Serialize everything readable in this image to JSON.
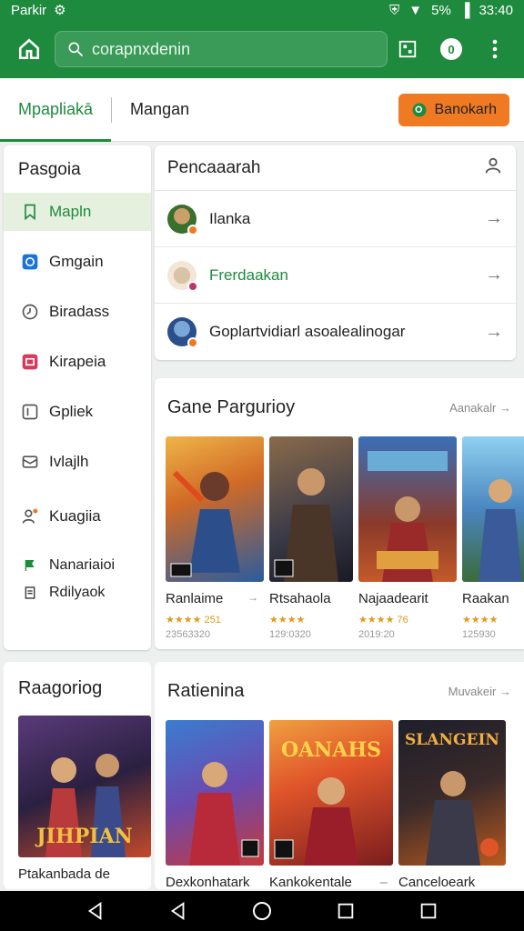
{
  "status_bar": {
    "left_text": "Parkir",
    "battery": "5%",
    "time": "33:40"
  },
  "app_bar": {
    "search_text": "corapnxdenin"
  },
  "tabs": [
    {
      "label": "Mpapliakā",
      "active": true
    },
    {
      "label": "Mangan",
      "active": false
    }
  ],
  "primary_button": {
    "label": "Banokarh"
  },
  "sidebar": {
    "title": "Pasgoia",
    "items": [
      {
        "label": "Mapln",
        "icon": "bookmark-icon",
        "active": true
      },
      {
        "label": "Gmgain",
        "icon": "blue-square-icon"
      },
      {
        "label": "Biradass",
        "icon": "clock-icon"
      },
      {
        "label": "Kirapeia",
        "icon": "red-app-icon"
      },
      {
        "label": "Gpliek",
        "icon": "square-outline-icon"
      },
      {
        "label": "Ivlajlh",
        "icon": "mail-icon"
      },
      {
        "label": "Kuagiia",
        "icon": "person-icon"
      }
    ],
    "footer": [
      {
        "label": "Nanariaioi",
        "icon": "flag-icon"
      },
      {
        "label": "Rdilyaok",
        "icon": "doc-icon"
      }
    ]
  },
  "list_card": {
    "title": "Pencaaarah",
    "rows": [
      {
        "label": "Ilanka",
        "color": "#2f7d3a"
      },
      {
        "label": "Frerdaakan",
        "color": "#1e8a3e"
      },
      {
        "label": "Goplartvidiarl asoalealinogar",
        "color": "#222"
      }
    ]
  },
  "games_section": {
    "title": "Gane Pargurioy",
    "more": "Aanakalr",
    "games": [
      {
        "name": "Ranlaime",
        "rating": "★★★★ 251",
        "downloads": "23563320",
        "colors": [
          "#e8a23a",
          "#2a5c9e"
        ]
      },
      {
        "name": "Rtsahaola",
        "rating": "★★★★",
        "downloads": "129:0320",
        "colors": [
          "#6a4b3a",
          "#2c2c3a"
        ]
      },
      {
        "name": "Najaadearit",
        "rating": "★★★★ 76",
        "downloads": "2019:20",
        "colors": [
          "#3a6fb8",
          "#c45a2a"
        ]
      },
      {
        "name": "Raakan",
        "rating": "★★★★",
        "downloads": "125930",
        "colors": [
          "#6fb3e0",
          "#3b6b3a"
        ]
      }
    ]
  },
  "bottom_left": {
    "title": "Raagoriog",
    "art_title": "JIHPIAN",
    "caption": "Ptakanbada de"
  },
  "bottom_right": {
    "title": "Ratienina",
    "more": "Muvakeir",
    "games": [
      {
        "name": "Dexkonhatark",
        "colors": [
          "#3a7dd0",
          "#c43a3a"
        ]
      },
      {
        "name": "Kankokentale",
        "colors": [
          "#e0542a",
          "#7a1d1d"
        ],
        "art_title": "OANAHS"
      },
      {
        "name": "Canceloeark",
        "colors": [
          "#2a2a3a",
          "#b85a1e"
        ],
        "art_title": "SLANGEIN"
      }
    ]
  }
}
